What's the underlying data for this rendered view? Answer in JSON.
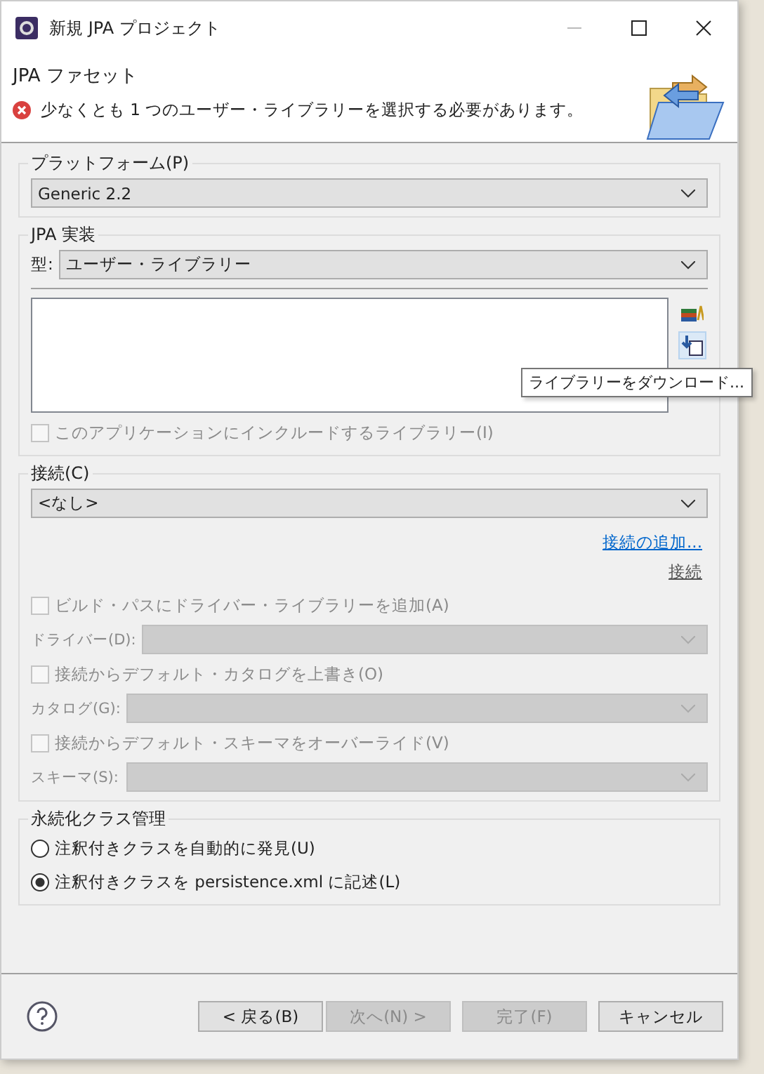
{
  "window": {
    "title": "新規 JPA プロジェクト"
  },
  "header": {
    "title": "JPA ファセット",
    "message": "少なくとも 1 つのユーザー・ライブラリーを選択する必要があります。"
  },
  "platform": {
    "label": "プラットフォーム(P)",
    "value": "Generic 2.2"
  },
  "implementation": {
    "label": "JPA 実装",
    "type_label": "型:",
    "type_value": "ユーザー・ライブラリー",
    "tooltip": "ライブラリーをダウンロード...",
    "include_checkbox": {
      "label": "このアプリケーションにインクルードするライブラリー(I)",
      "checked": false,
      "disabled": true
    }
  },
  "connection": {
    "label": "接続(C)",
    "value": "<なし>",
    "add_link": "接続の追加...",
    "connect_link": "接続",
    "options": [
      {
        "kind": "checkbox",
        "label": "ビルド・パスにドライバー・ライブラリーを追加(A)",
        "checked": false,
        "disabled": true
      },
      {
        "kind": "select",
        "label": "ドライバー(D):",
        "disabled": true
      },
      {
        "kind": "checkbox",
        "label": "接続からデフォルト・カタログを上書き(O)",
        "checked": false,
        "disabled": true
      },
      {
        "kind": "select",
        "label": "カタログ(G):",
        "disabled": true
      },
      {
        "kind": "checkbox",
        "label": "接続からデフォルト・スキーマをオーバーライド(V)",
        "checked": false,
        "disabled": true
      },
      {
        "kind": "select",
        "label": "スキーマ(S):",
        "disabled": true
      }
    ]
  },
  "persistence": {
    "label": "永続化クラス管理",
    "options": [
      {
        "label": "注釈付きクラスを自動的に発見(U)",
        "selected": false
      },
      {
        "label": "注釈付きクラスを persistence.xml に記述(L)",
        "selected": true
      }
    ]
  },
  "buttons": [
    {
      "label": "< 戻る(B)",
      "disabled": false
    },
    {
      "label": "次へ(N) >",
      "disabled": true
    },
    {
      "label": "完了(F)",
      "disabled": true
    },
    {
      "label": "キャンセル",
      "disabled": false
    }
  ]
}
